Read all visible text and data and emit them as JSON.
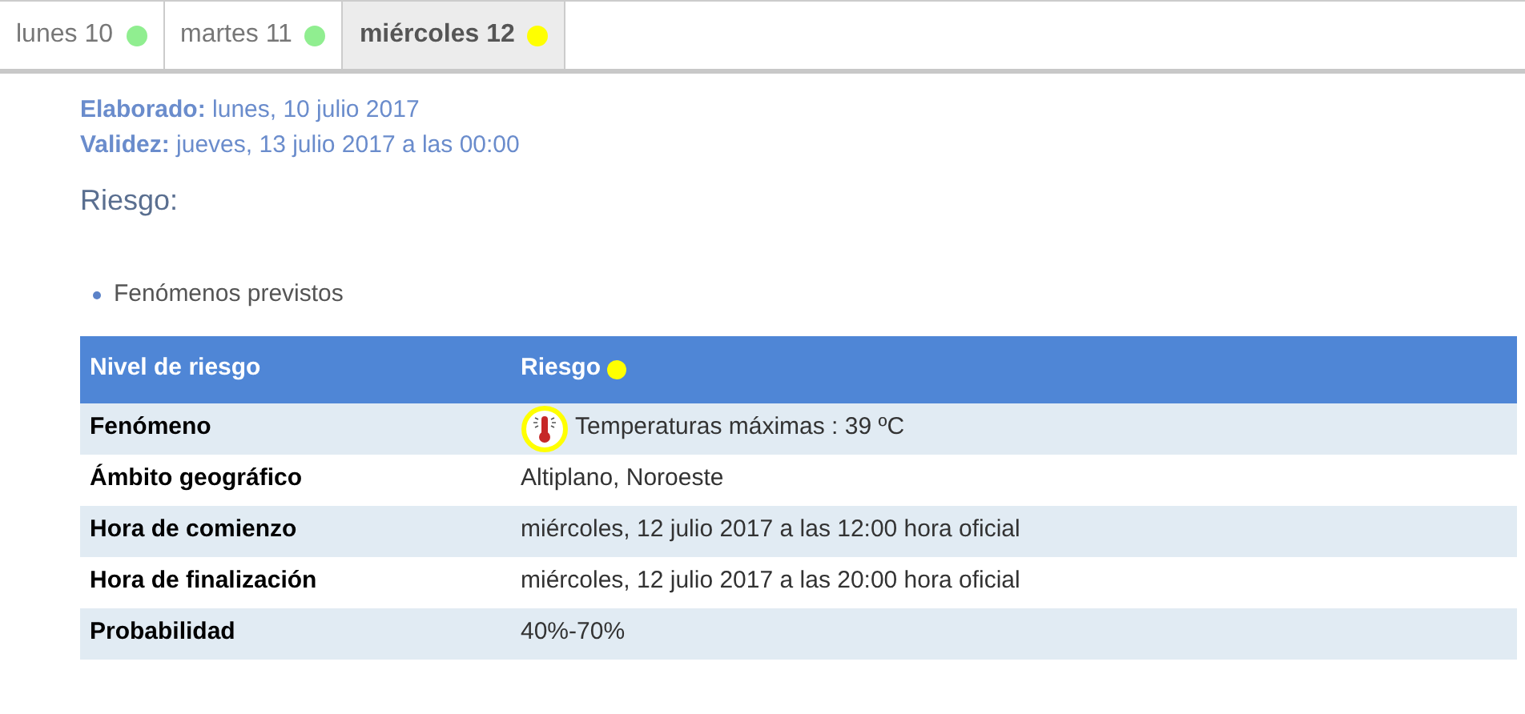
{
  "tabs": [
    {
      "label": "lunes 10",
      "color": "#90ee90",
      "selected": false
    },
    {
      "label": "martes 11",
      "color": "#90ee90",
      "selected": false
    },
    {
      "label": "miércoles 12",
      "color": "#ffff00",
      "selected": true
    }
  ],
  "meta": [
    {
      "label": "Elaborado:",
      "value": "lunes, 10 julio 2017"
    },
    {
      "label": "Validez:",
      "value": "jueves, 13 julio 2017 a las 00:00"
    }
  ],
  "heading": "Riesgo:",
  "bullets": [
    "Fenómenos previstos"
  ],
  "table": {
    "columns": [
      {
        "label": "Nivel de riesgo"
      },
      {
        "label": "Riesgo",
        "color": "#ffff00"
      }
    ],
    "rows": [
      {
        "label": "Fenómeno",
        "value": "Temperaturas máximas : 39 ºC",
        "kind": "icon",
        "color": "#ffff00"
      },
      {
        "label": "Ámbito geográfico",
        "value": "Altiplano, Noroeste",
        "kind": "text"
      },
      {
        "label": "Hora de comienzo",
        "value": "miércoles, 12 julio 2017 a las 12:00 hora oficial",
        "kind": "text"
      },
      {
        "label": "Hora de finalización",
        "value": "miércoles, 12 julio 2017 a las 20:00 hora oficial",
        "kind": "text"
      },
      {
        "label": "Probabilidad",
        "value": "40%-70%",
        "kind": "text"
      }
    ]
  }
}
